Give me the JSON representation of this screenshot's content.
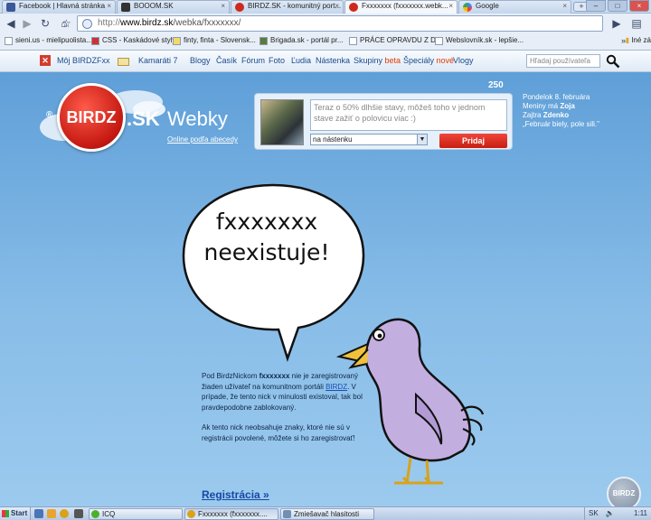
{
  "browser": {
    "tabs": [
      {
        "title": "Facebook | Hlavná stránka",
        "icon": "facebook-icon",
        "color": "#3b5998"
      },
      {
        "title": "BOOOM.SK",
        "icon": "booom-icon",
        "color": "#333333"
      },
      {
        "title": "BIRDZ.SK - komunitný port...",
        "icon": "birdz-icon",
        "color": "#d0281c"
      },
      {
        "title": "Fxxxxxxx (fxxxxxxx.webk...",
        "icon": "birdz-icon",
        "color": "#d0281c"
      },
      {
        "title": "Google",
        "icon": "google-icon",
        "color": "#4285f4"
      }
    ],
    "url_host": "www.birdz.sk",
    "url_path": "/webka/fxxxxxxx/",
    "url_scheme": "http://",
    "bookmarks": [
      {
        "label": "sieni.us - mielipuolista..."
      },
      {
        "label": "CSS - Kaskádové styly"
      },
      {
        "label": "finty, finta - Slovensk..."
      },
      {
        "label": "Brigada.sk - portál pr..."
      },
      {
        "label": "PRÁCE OPRAVDU Z D..."
      },
      {
        "label": "Webslovník.sk - lepšie..."
      }
    ],
    "bookmarks_more": "»",
    "bookmarks_other": "Iné zá"
  },
  "site": {
    "nav": {
      "my_birdz": "Môj BIRDZ",
      "fxx": "Fxx",
      "friends": "Kamaráti 7",
      "blogy": "Blogy",
      "casik": "Časík",
      "forum": "Fórum",
      "foto": "Foto",
      "ludia": "Ľudia",
      "nastenka": "Nástenka",
      "skupiny": "Skupiny",
      "skupiny_badge": "beta",
      "specialy": "Špeciály",
      "specialy_badge": "nové",
      "vlogy": "Vlogy",
      "user_search_placeholder": "Hľadaj používateľa"
    },
    "logo": {
      "reg": "®",
      "brand": "BIRDZ",
      "tld": ".SK"
    },
    "section_title": "Webky",
    "section_subtitle": "Online podľa abecedy",
    "post": {
      "char_count": "250",
      "placeholder": "Teraz o 50% dlhšie stavy, môžeš toho v jednom stave zažiť o polovicu viac :)",
      "target_select": "na nástenku",
      "submit": "Pridaj"
    },
    "date": {
      "line1": "Pondelok 8. februára",
      "name_today_label": "Meniny má",
      "name_today": "Zoja",
      "name_tomorrow_label": "Zajtra",
      "name_tomorrow": "Zdenko",
      "proverb": "„Február biely, pole sili.\""
    },
    "bubble": {
      "line1": "fxxxxxxx",
      "line2": "neexistuje!"
    },
    "info": {
      "p1_a": "Pod BirdzNickom ",
      "p1_nick": "fxxxxxxx",
      "p1_b": " nie je zaregistrovaný žiaden užívateľ na komunitnom portáli ",
      "p1_link": "BIRDZ",
      "p1_c": ". V prípade, že tento nick v minulosti existoval, tak bol pravdepodobne zablokovaný.",
      "p2": "Ak tento nick neobsahuje znaky, ktoré nie sú v registrácii povolené, môžete si ho zaregistrovať!"
    },
    "register_link": "Registrácia »",
    "corner_badge": "BIRDZ"
  },
  "taskbar": {
    "start": "Start",
    "items": [
      {
        "label": "ICQ",
        "icon": "icq-icon",
        "color": "#4caf2a"
      },
      {
        "label": "Fxxxxxxx (fxxxxxxx....",
        "icon": "chrome-icon",
        "color": "#d9a21b"
      },
      {
        "label": "Zmiešavač hlasitosti",
        "icon": "volume-mixer-icon",
        "color": "#6f8fb5"
      }
    ],
    "tray_lang": "SK",
    "clock": "1:11"
  },
  "colors": {
    "brand_red": "#d0281c",
    "page_blue": "#6aa6dc",
    "link_blue": "#1748a4"
  }
}
